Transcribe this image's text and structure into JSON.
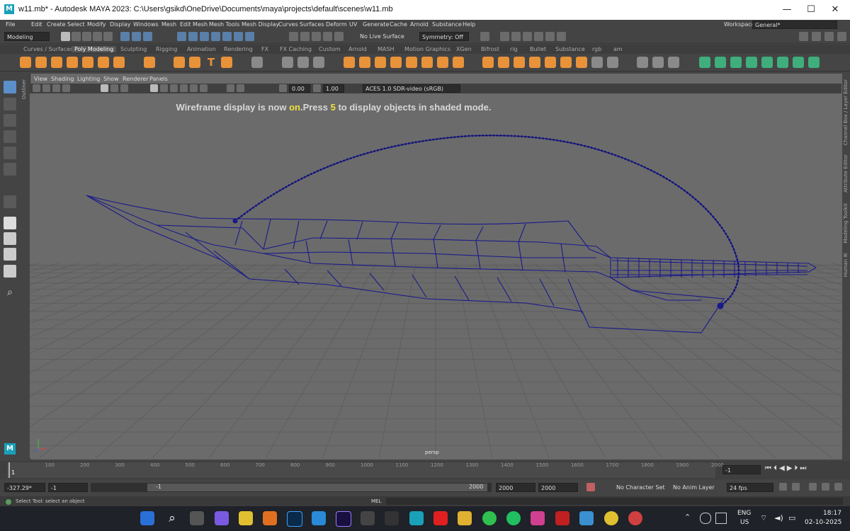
{
  "window": {
    "title": "w11.mb* - Autodesk MAYA 2023: C:\\Users\\gsikd\\OneDrive\\Documents\\maya\\projects\\default\\scenes\\w11.mb",
    "logo_letter": "M",
    "minimize": "—",
    "maximize": "☐",
    "close": "✕"
  },
  "menu": [
    "File",
    "Edit",
    "Create",
    "Select",
    "Modify",
    "Display",
    "Windows",
    "Mesh",
    "Edit Mesh",
    "Mesh Tools",
    "Mesh Display",
    "Curves",
    "Surfaces",
    "Deform",
    "UV",
    "Generate",
    "Cache",
    "Arnold",
    "Substance",
    "Help"
  ],
  "workspace": {
    "label": "Workspace:",
    "value": "General*"
  },
  "statusline": {
    "mode": "Modeling",
    "live_surface": "No Live Surface",
    "symmetry": "Symmetry: Off"
  },
  "shelf_tabs": [
    "Curves / Surfaces",
    "Poly Modeling",
    "Sculpting",
    "Rigging",
    "Animation",
    "Rendering",
    "FX",
    "FX Caching",
    "Custom",
    "Arnold",
    "MASH",
    "Motion Graphics",
    "XGen",
    "Bifrost",
    "rig",
    "Bullet",
    "Substance",
    "rgb",
    "am"
  ],
  "shelf_active": "Poly Modeling",
  "panel_menu": [
    "View",
    "Shading",
    "Lighting",
    "Show",
    "Renderer",
    "Panels"
  ],
  "panel_toolbar": {
    "exposure": "0.00",
    "gamma": "1.00",
    "color_space": "ACES 1.0 SDR-video (sRGB)"
  },
  "viewport": {
    "msg_pre": "Wireframe display is now ",
    "msg_on": "on",
    "msg_mid": ".Press ",
    "msg_key": "5",
    "msg_post": " to display objects in shaded mode.",
    "camera": "persp",
    "wire_color": "#1a1a8c",
    "bg_color": "#6b6b6b",
    "grid_color": "#5a5a5a"
  },
  "side_labels": [
    "Channel Box / Layer Editor",
    "Attribute Editor",
    "Modeling Toolkit",
    "Human IK"
  ],
  "outliner_label": "Outliner",
  "timeline": {
    "ticks": [
      "1",
      "100",
      "200",
      "300",
      "400",
      "500",
      "600",
      "700",
      "800",
      "900",
      "1000",
      "1100",
      "1200",
      "1300",
      "1400",
      "1500",
      "1600",
      "1700",
      "1800",
      "1900",
      "2000"
    ],
    "current_frame": "1"
  },
  "range": {
    "start_outer": "-327.29*",
    "start": "-1",
    "range_start": "-1",
    "range_end": "2000",
    "end": "2000",
    "end_outer": "2000",
    "char_set": "No Character Set",
    "anim_layer": "No Anim Layer",
    "fps": "24 fps"
  },
  "cmdline": {
    "mel": "MEL",
    "help": "Select Tool: select an object"
  },
  "taskbar": {
    "lang": "ENG",
    "region": "US",
    "time": "18:17",
    "date": "02-10-2025"
  }
}
